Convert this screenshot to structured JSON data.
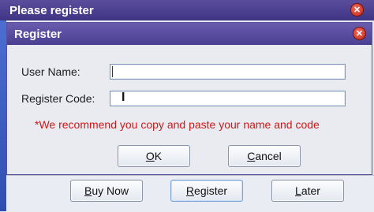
{
  "outer_window": {
    "title": "Please register"
  },
  "dialog": {
    "title": "Register",
    "username_label": "User Name:",
    "username_value": "",
    "register_code_label": "Register Code:",
    "register_code_value": "",
    "note": "*We recommend you copy and paste your name and code",
    "ok_label_underlined": "O",
    "ok_label_rest": "K",
    "cancel_label_underlined": "C",
    "cancel_label_rest": "ancel"
  },
  "bottom_bar": {
    "buy_now_pre": "",
    "buy_now_underlined": "B",
    "buy_now_rest": "uy Now",
    "register_underlined": "R",
    "register_rest": "egister",
    "later_underlined": "L",
    "later_rest": "ater"
  },
  "icons": {
    "close": "close-icon",
    "text_cursor": "ibeam-cursor-icon"
  },
  "colors": {
    "title_bar": "#4a3f92",
    "note_text": "#d01818",
    "close_button": "#c4281b"
  }
}
